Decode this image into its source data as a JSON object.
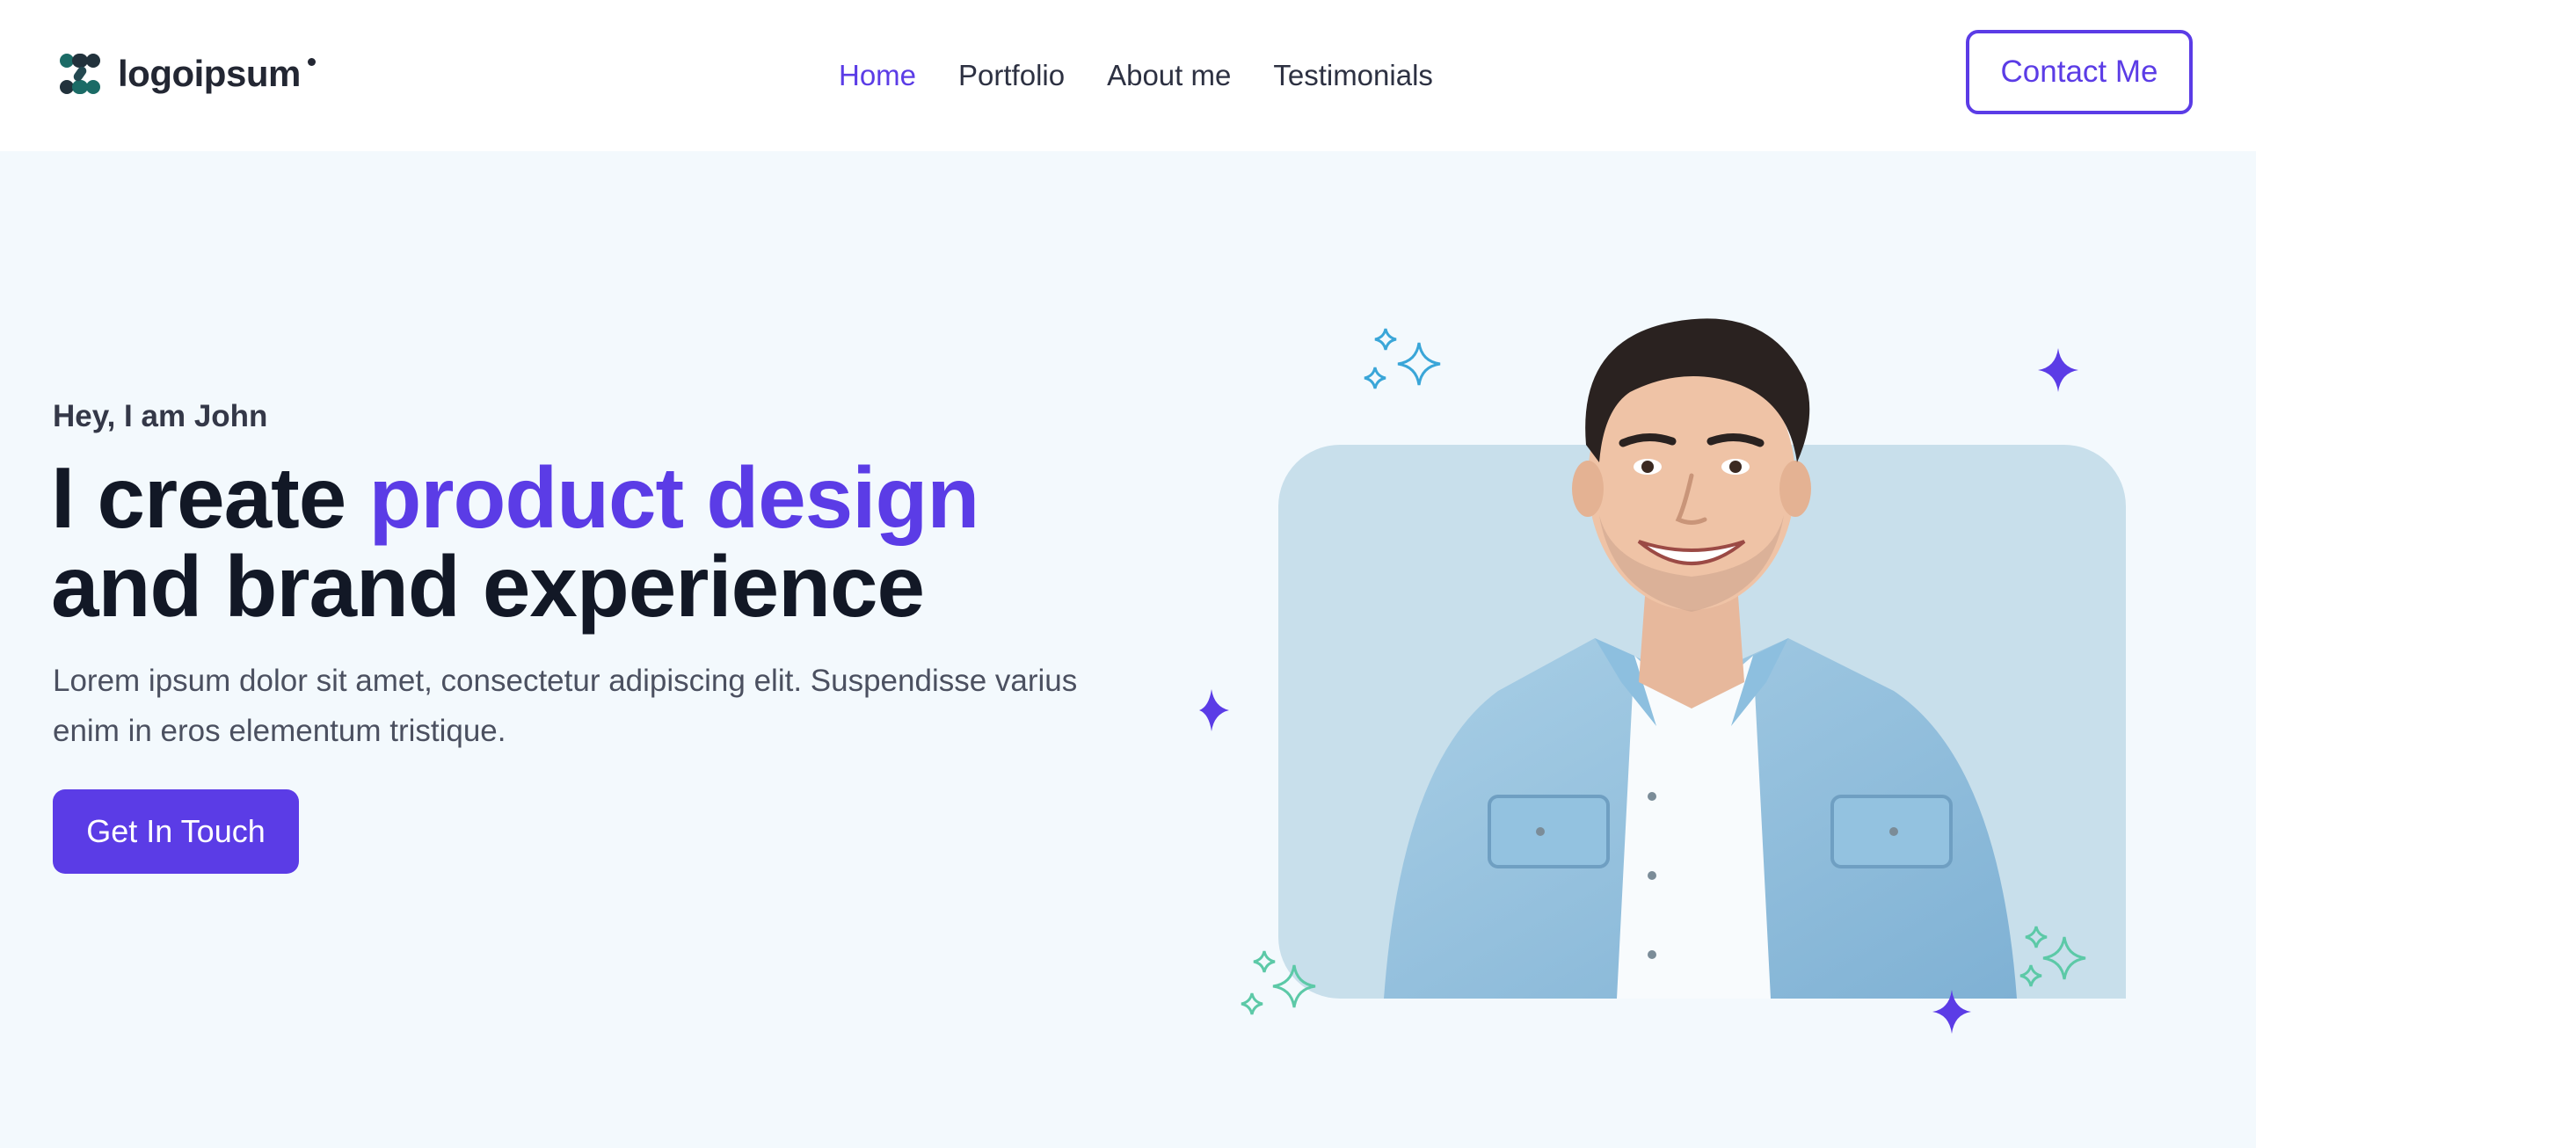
{
  "header": {
    "logo_text": "logoipsum",
    "nav": [
      {
        "label": "Home",
        "active": true
      },
      {
        "label": "Portfolio",
        "active": false
      },
      {
        "label": "About me",
        "active": false
      },
      {
        "label": "Testimonials",
        "active": false
      }
    ],
    "contact_label": "Contact Me"
  },
  "hero": {
    "greeting": "Hey, I am John",
    "headline_part1": "I create ",
    "headline_accent": "product design",
    "headline_part2": "and brand experience",
    "description": "Lorem ipsum dolor sit amet, consectetur adipiscing elit. Suspendisse varius enim in eros elementum tristique.",
    "cta_label": "Get In Touch"
  },
  "colors": {
    "accent": "#5b3ce6",
    "hero_background": "#f3f9fd",
    "photo_card": "#c8dfeb",
    "sparkle_blue": "#3aa6d8",
    "sparkle_green": "#5cc9a7"
  },
  "icons": [
    "logo-icon",
    "sparkle-icon",
    "portrait-image"
  ]
}
